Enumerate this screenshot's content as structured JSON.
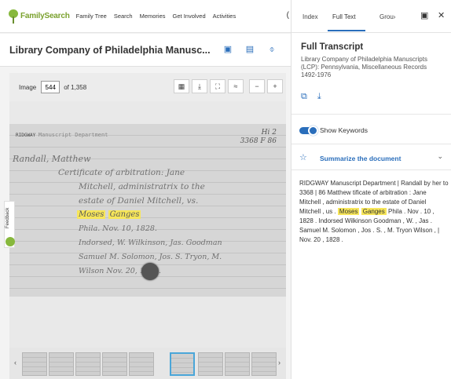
{
  "nav": {
    "logo": "FamilySearch",
    "links": [
      "Family Tree",
      "Search",
      "Memories",
      "Get Involved",
      "Activities"
    ],
    "more_glyph": "("
  },
  "title": {
    "text": "Library Company of Philadelphia Manusc...",
    "icons": [
      "image-viewer-icon",
      "notebook-icon",
      "attach-icon"
    ]
  },
  "viewer": {
    "image_label": "Image",
    "image_value": "544",
    "image_of": "of 1,358",
    "tools": [
      {
        "name": "grid-icon",
        "glyph": "▦"
      },
      {
        "name": "download-icon",
        "glyph": "⤓"
      },
      {
        "name": "fullscreen-icon",
        "glyph": "⛶"
      },
      {
        "name": "adjust-icon",
        "glyph": "≈"
      },
      {
        "name": "zoom-out-icon",
        "glyph": "−"
      },
      {
        "name": "zoom-in-icon",
        "glyph": "+"
      }
    ]
  },
  "document": {
    "header_left": "RIDGWAY",
    "header_stamp": "Manuscript Department",
    "card_number_top": "Hi 2",
    "card_number_bottom": "3368 F 86",
    "lines": [
      "Randall, Matthew",
      "Certificate of arbitration: Jane",
      "Mitchell, administratrix to the",
      "estate of Daniel Mitchell, vs.",
      "Phila. Nov. 10, 1828.",
      "Indorsed, W. Wilkinson, Jas. Goodman",
      "Samuel M. Solomon, Jos. S. Tryon, M.",
      "Wilson    Nov. 20, 1828."
    ],
    "highlight_1": "Moses",
    "highlight_2": "Ganges"
  },
  "feedback": {
    "label": "Feedback"
  },
  "filmstrip": {
    "left_arrow": "‹",
    "right_arrow": "›"
  },
  "panel": {
    "tabs": [
      "Index",
      "Full Text",
      "Grou›"
    ],
    "active_tab": "Full Text",
    "tab_icons": [
      {
        "name": "panel-layout-icon",
        "glyph": "▣"
      },
      {
        "name": "close-icon",
        "glyph": "✕"
      }
    ],
    "heading": "Full Transcript",
    "subtitle": "Library Company of Philadelphia Manuscripts (LCP): Pennsylvania, Miscellaneous Records 1492-1976",
    "copy_glyph": "⧉",
    "download_glyph": "⤓",
    "show_keywords": "Show Keywords",
    "summarize": "Summarize the document",
    "summarize_star": "☆",
    "chevron": "⌄",
    "transcript_before": "RIDGWAY Manuscript Department | Randall by her to 3368 | 86 Matthew tificate of arbitration : Jane Mitchell , administratrix to the estate of Daniel Mitchell , us .",
    "keyword_1": "Moses",
    "keyword_2": "Ganges",
    "transcript_after": "Phila . Nov . 10 , 1828 . Indorsed Wilkinson Goodman , W. , Jas . Samuel M. Solomon , Jos . S. , M. Tryon Wilson , | Nov. 20 , 1828 .",
    "accent": "#2a6ebb",
    "highlight": "#f7e65a"
  }
}
